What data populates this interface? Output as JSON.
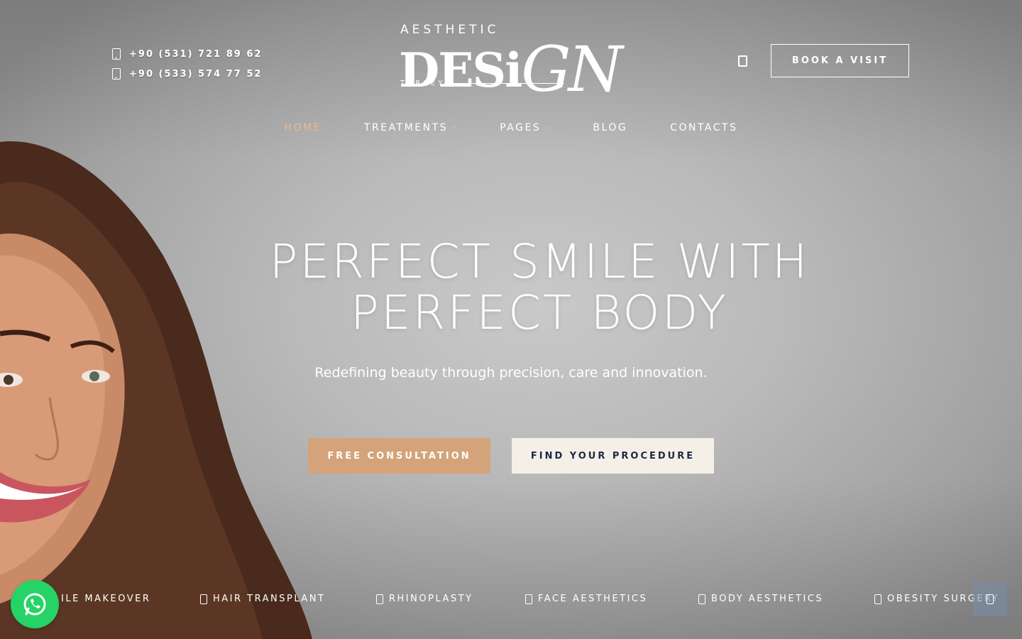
{
  "header": {
    "phones": [
      "+90 (531) 721 89 62",
      "+90 (533) 574 77 52"
    ],
    "logo": {
      "top": "AESTHETIC",
      "main_a": "DESi",
      "main_b": "GN",
      "bottom": "TURKEY"
    },
    "book_label": "BOOK A VISIT",
    "search_icon": "search-icon"
  },
  "nav": {
    "items": [
      {
        "label": "HOME",
        "active": true,
        "dropdown": false
      },
      {
        "label": "TREATMENTS",
        "active": false,
        "dropdown": true
      },
      {
        "label": "PAGES",
        "active": false,
        "dropdown": true
      },
      {
        "label": "BLOG",
        "active": false,
        "dropdown": false
      },
      {
        "label": "CONTACTS",
        "active": false,
        "dropdown": false
      }
    ],
    "chevron": "◦"
  },
  "hero": {
    "title_line1": "PERFECT SMILE WITH",
    "title_line2": "PERFECT BODY",
    "subtitle": "Redefining beauty through precision, care and innovation.",
    "cta_primary": "FREE CONSULTATION",
    "cta_secondary": "FIND YOUR PROCEDURE"
  },
  "ticker": {
    "items": [
      "ILE MAKEOVER",
      "HAIR TRANSPLANT",
      "RHINOPLASTY",
      "FACE AESTHETICS",
      "BODY AESTHETICS",
      "OBESITY SURGERY"
    ]
  },
  "colors": {
    "accent": "#d5a37a",
    "active_nav": "#e9b98f",
    "navy": "#1d2846",
    "whatsapp": "#25d366"
  }
}
